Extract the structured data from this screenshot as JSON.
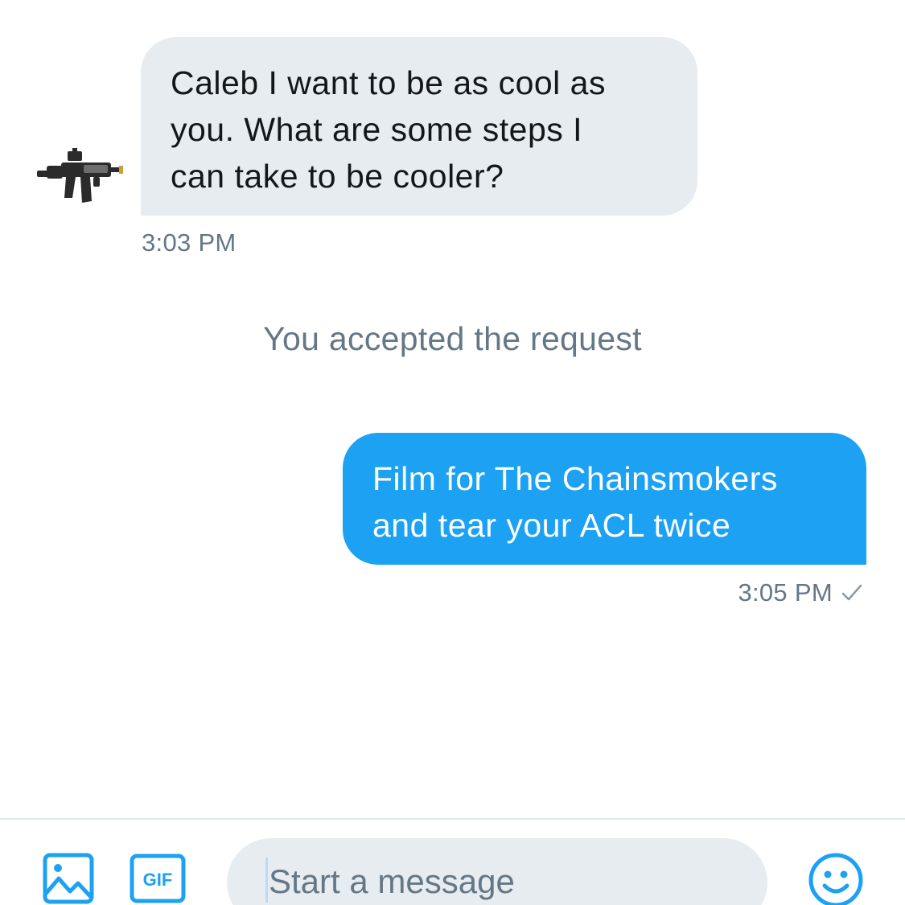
{
  "conversation": {
    "incoming": {
      "lines": [
        "Caleb I want to be as cool as",
        "you. What are some steps I",
        "can take to be cooler?"
      ],
      "time": "3:03 PM",
      "avatar_icon": "rifle-avatar-icon"
    },
    "system_message": "You accepted the request",
    "outgoing": {
      "lines": [
        "Film for The Chainsmokers",
        "and tear your ACL twice"
      ],
      "time": "3:05 PM",
      "status_icon": "checkmark-icon"
    }
  },
  "composer": {
    "placeholder": "Start a message",
    "value": "",
    "photo_icon": "photo-icon",
    "gif_label": "GIF",
    "emoji_icon": "emoji-icon"
  },
  "colors": {
    "accent": "#1da1f2",
    "incoming_bubble": "#e6ecf0",
    "secondary_text": "#657786",
    "primary_text": "#14171a"
  }
}
